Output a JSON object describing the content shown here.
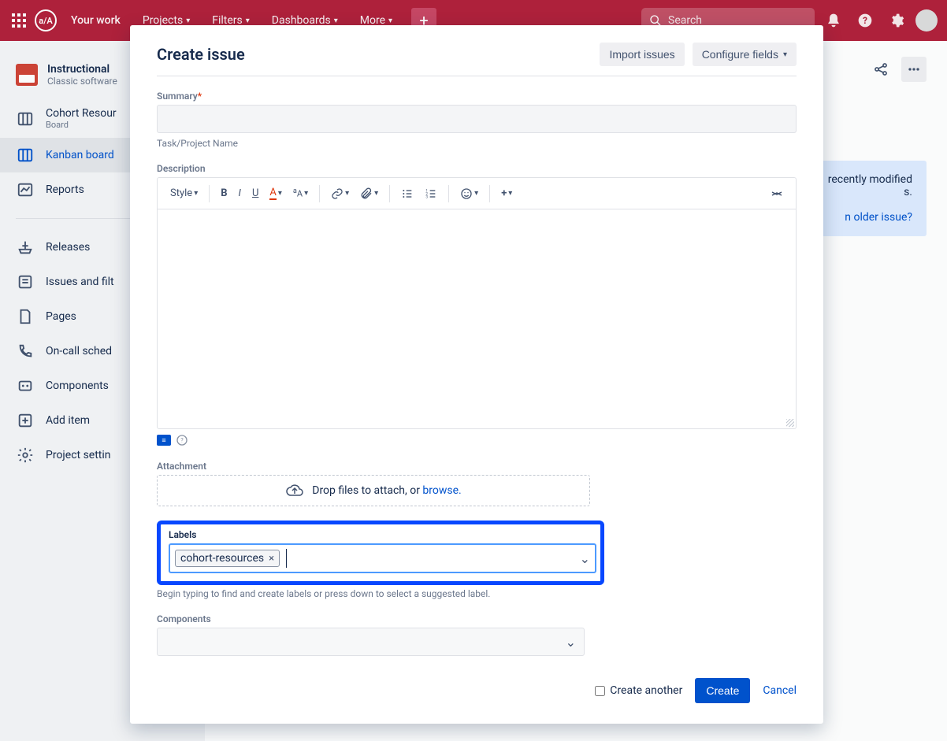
{
  "topnav": {
    "your_work": "Your work",
    "projects": "Projects",
    "filters": "Filters",
    "dashboards": "Dashboards",
    "more": "More",
    "search_placeholder": "Search"
  },
  "sidebar": {
    "project_title": "Instructional",
    "project_type": "Classic software",
    "item1_label": "Cohort Resour",
    "item1_sub": "Board",
    "item2_label": "Kanban board",
    "item3_label": "Reports",
    "item4_label": "Releases",
    "item5_label": "Issues and filt",
    "item6_label": "Pages",
    "item7_label": "On-call sched",
    "item8_label": "Components",
    "item9_label": "Add item",
    "item10_label": "Project settin"
  },
  "banner": {
    "text1": "recently modified",
    "text2": "s.",
    "link": "n older issue?"
  },
  "modal": {
    "title": "Create issue",
    "import_btn": "Import issues",
    "configure_btn": "Configure fields",
    "summary_label": "Summary",
    "summary_help": "Task/Project Name",
    "description_label": "Description",
    "style_btn": "Style",
    "attachment_label": "Attachment",
    "attach_text": "Drop files to attach, or ",
    "attach_link": "browse.",
    "labels_label": "Labels",
    "label_tag": "cohort-resources",
    "labels_help": "Begin typing to find and create labels or press down to select a suggested label.",
    "components_label": "Components",
    "create_another": "Create another",
    "create_btn": "Create",
    "cancel_btn": "Cancel"
  }
}
